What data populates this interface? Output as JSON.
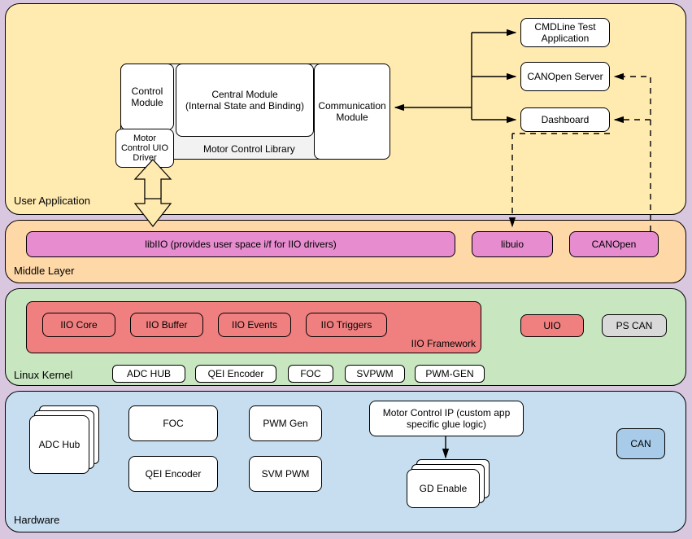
{
  "layers": {
    "user": {
      "label": "User Application"
    },
    "middle": {
      "label": "Middle Layer"
    },
    "kernel": {
      "label": "Linux Kernel"
    },
    "hw": {
      "label": "Hardware"
    }
  },
  "user_app": {
    "library_label": "Motor Control Library",
    "control_module": "Control Module",
    "uio_driver": "Motor Control UIO Driver",
    "central_module_line1": "Central Module",
    "central_module_line2": "(Internal State and Binding)",
    "comm_module": "Communication Module",
    "cmdline": "CMDLine Test Application",
    "canopen_server": "CANOpen Server",
    "dashboard": "Dashboard"
  },
  "middle": {
    "libiio": "libIIO (provides user space i/f for IIO drivers)",
    "libuio": "libuio",
    "canopen": "CANOpen"
  },
  "kernel": {
    "framework_label": "IIO Framework",
    "iio_core": "IIO Core",
    "iio_buffer": "IIO Buffer",
    "iio_events": "IIO Events",
    "iio_triggers": "IIO Triggers",
    "uio": "UIO",
    "ps_can": "PS CAN",
    "adc_hub": "ADC HUB",
    "qei_enc": "QEI Encoder",
    "foc": "FOC",
    "svpwm": "SVPWM",
    "pwm_gen": "PWM-GEN"
  },
  "hw": {
    "adc_hub": "ADC Hub",
    "foc": "FOC",
    "qei_enc": "QEI Encoder",
    "pwm_gen": "PWM Gen",
    "svm_pwm": "SVM PWM",
    "mc_ip": "Motor Control IP (custom app specific glue logic)",
    "gd_enable": "GD Enable",
    "can": "CAN"
  }
}
